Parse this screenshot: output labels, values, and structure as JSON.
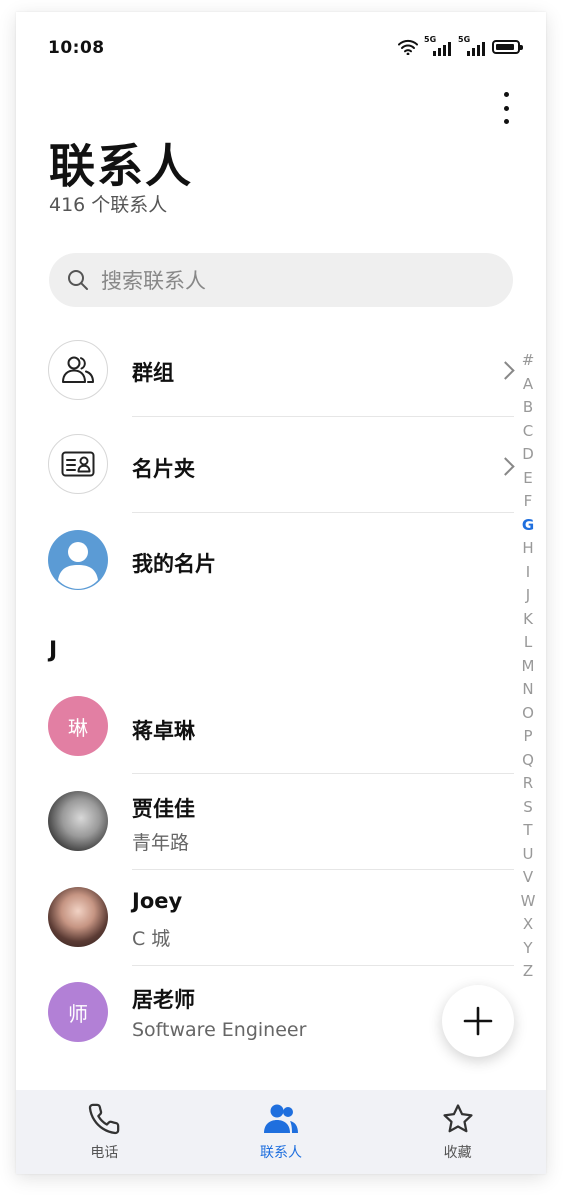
{
  "status": {
    "time": "10:08",
    "network1": "5G",
    "network2": "5G"
  },
  "header": {
    "title": "联系人",
    "subtitle": "416 个联系人"
  },
  "search": {
    "placeholder": "搜索联系人"
  },
  "entries": [
    {
      "label": "群组",
      "icon": "group-icon"
    },
    {
      "label": "名片夹",
      "icon": "business-card-icon"
    },
    {
      "label": "我的名片",
      "icon": "person-icon"
    }
  ],
  "section": "J",
  "contacts": [
    {
      "name": "蒋卓琳",
      "initial": "琳",
      "color": "#e27fa3"
    },
    {
      "name": "贾佳佳",
      "subtitle": "青年路"
    },
    {
      "name": "Joey",
      "subtitle": "C 城"
    },
    {
      "name": "居老师",
      "initial": "师",
      "subtitle": "Software Engineer",
      "color": "#b280d6"
    }
  ],
  "alphabet": [
    "#",
    "A",
    "B",
    "C",
    "D",
    "E",
    "F",
    "G",
    "H",
    "I",
    "J",
    "K",
    "L",
    "M",
    "N",
    "O",
    "P",
    "Q",
    "R",
    "S",
    "T",
    "U",
    "V",
    "W",
    "X",
    "Y",
    "Z"
  ],
  "alphabet_active": "G",
  "nav": [
    {
      "label": "电话",
      "icon": "phone-icon"
    },
    {
      "label": "联系人",
      "icon": "contacts-icon",
      "active": true
    },
    {
      "label": "收藏",
      "icon": "star-icon"
    }
  ],
  "colors": {
    "accent": "#1f6fde",
    "my_card_avatar": "#5b9bd5"
  }
}
